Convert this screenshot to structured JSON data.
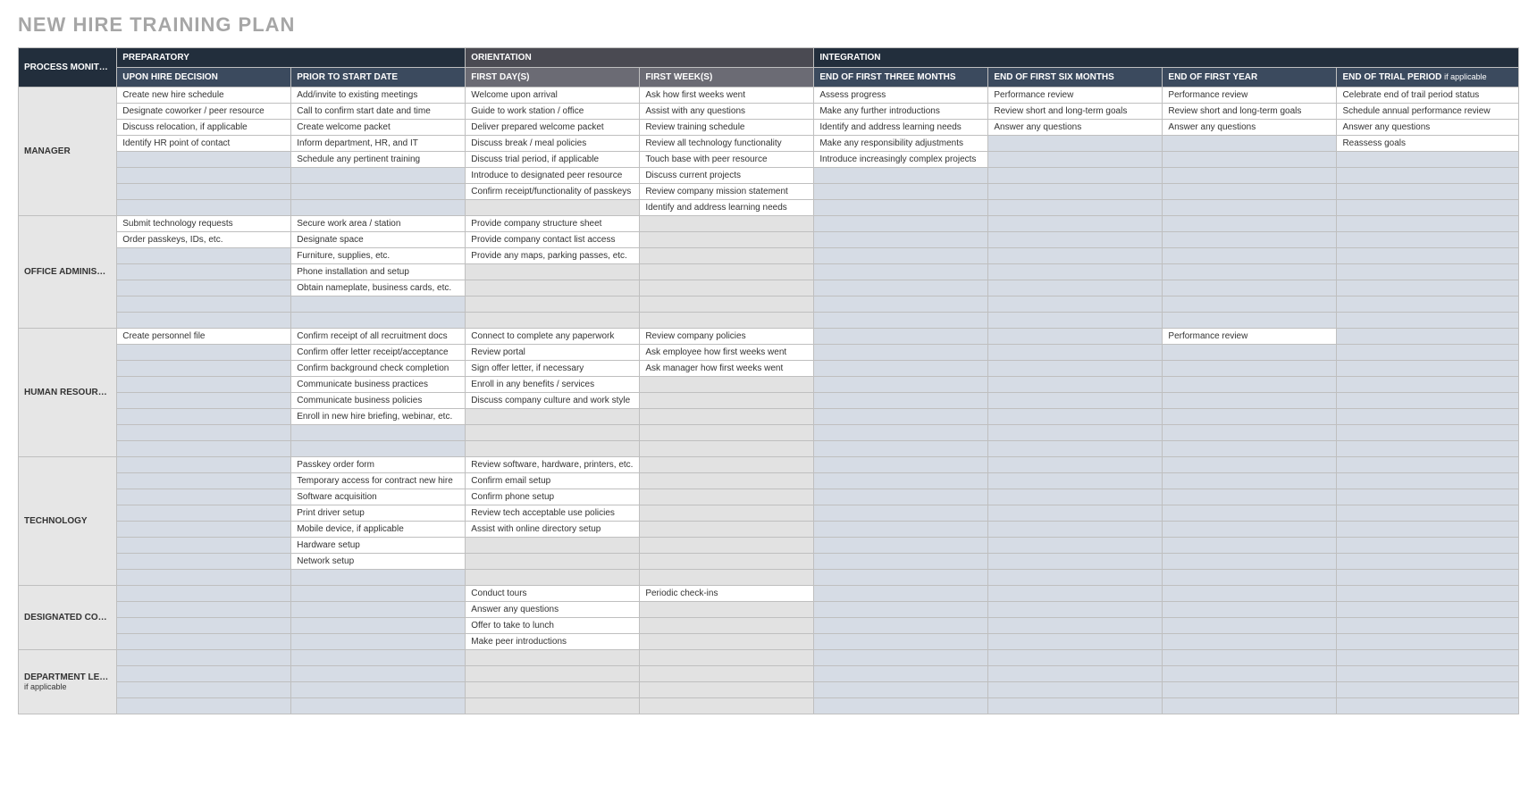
{
  "title": "NEW HIRE TRAINING PLAN",
  "cornerHeader": "PROCESS MONITOR / MENTOR",
  "phaseHeaders": {
    "prep": "PREPARATORY",
    "orient": "ORIENTATION",
    "integ": "INTEGRATION"
  },
  "subHeaders": {
    "uponHire": "UPON HIRE DECISION",
    "priorStart": "PRIOR TO START DATE",
    "firstDays": "FIRST DAY(S)",
    "firstWeeks": "FIRST WEEK(S)",
    "threeMonths": "END OF FIRST THREE MONTHS",
    "sixMonths": "END OF FIRST SIX MONTHS",
    "firstYear": "END OF FIRST YEAR",
    "trialPeriod": "END OF TRIAL PERIOD",
    "trialNote": "if applicable"
  },
  "roles": {
    "manager": "MANAGER",
    "officeAdmin": "OFFICE ADMINISTRATOR",
    "hr": "HUMAN RESOURCES",
    "tech": "TECHNOLOGY",
    "coworker": "DESIGNATED COWORKER / PEER RESOURCE",
    "deptLead": "DEPARTMENT LEAD",
    "deptNote": "if applicable"
  },
  "sections": {
    "manager": {
      "rows": 8,
      "cells": {
        "0.0": "Create new hire schedule",
        "0.1": "Add/invite to existing meetings",
        "0.2": "Welcome upon arrival",
        "0.3": "Ask how first weeks went",
        "0.4": "Assess progress",
        "0.5": "Performance review",
        "0.6": "Performance review",
        "0.7": "Celebrate end of trail period status",
        "1.0": "Designate coworker / peer resource",
        "1.1": "Call to confirm start date and time",
        "1.2": "Guide to work station / office",
        "1.3": "Assist with any questions",
        "1.4": "Make any further introductions",
        "1.5": "Review short and long-term goals",
        "1.6": "Review short and long-term goals",
        "1.7": "Schedule annual performance review",
        "2.0": "Discuss relocation, if applicable",
        "2.1": "Create welcome packet",
        "2.2": "Deliver prepared welcome packet",
        "2.3": "Review training schedule",
        "2.4": "Identify and address learning needs",
        "2.5": "Answer any questions",
        "2.6": "Answer any questions",
        "2.7": "Answer any questions",
        "3.0": "Identify HR point of contact",
        "3.1": "Inform department, HR, and IT",
        "3.2": "Discuss break / meal policies",
        "3.3": "Review all technology functionality",
        "3.4": "Make any responsibility adjustments",
        "3.7": "Reassess goals",
        "4.1": "Schedule any pertinent training",
        "4.2": "Discuss trial period, if applicable",
        "4.3": "Touch base with peer resource",
        "4.4": "Introduce increasingly complex projects",
        "5.2": "Introduce to designated peer resource",
        "5.3": "Discuss current projects",
        "6.2": "Confirm receipt/functionality of passkeys",
        "6.3": "Review company mission statement",
        "7.3": "Identify and address learning needs"
      }
    },
    "officeAdmin": {
      "rows": 7,
      "cells": {
        "0.0": "Submit technology requests",
        "0.1": "Secure work area / station",
        "0.2": "Provide company structure sheet",
        "1.0": "Order passkeys, IDs, etc.",
        "1.1": "Designate space",
        "1.2": "Provide company contact list access",
        "2.1": "Furniture, supplies, etc.",
        "2.2": "Provide any maps, parking passes, etc.",
        "3.1": "Phone installation and setup",
        "4.1": "Obtain nameplate, business cards, etc."
      }
    },
    "hr": {
      "rows": 8,
      "cells": {
        "0.0": "Create personnel file",
        "0.1": "Confirm receipt of all recruitment docs",
        "0.2": "Connect to complete any paperwork",
        "0.3": "Review company policies",
        "0.6": "Performance review",
        "1.1": "Confirm offer letter receipt/acceptance",
        "1.2": "Review portal",
        "1.3": "Ask employee how first weeks went",
        "2.1": "Confirm background check completion",
        "2.2": "Sign offer letter, if necessary",
        "2.3": "Ask manager how first weeks went",
        "3.1": "Communicate business practices",
        "3.2": "Enroll in any benefits / services",
        "4.1": "Communicate business policies",
        "4.2": "Discuss company culture and work style",
        "5.1": "Enroll in new hire briefing, webinar, etc."
      }
    },
    "tech": {
      "rows": 8,
      "cells": {
        "0.1": "Passkey order form",
        "0.2": "Review software, hardware, printers, etc.",
        "1.1": "Temporary access for contract new hire",
        "1.2": "Confirm email setup",
        "2.1": "Software acquisition",
        "2.2": "Confirm phone setup",
        "3.1": "Print driver setup",
        "3.2": "Review tech acceptable use policies",
        "4.1": "Mobile device, if applicable",
        "4.2": "Assist with online directory setup",
        "5.1": "Hardware setup",
        "6.1": "Network setup"
      }
    },
    "coworker": {
      "rows": 4,
      "cells": {
        "0.2": "Conduct tours",
        "0.3": "Periodic check-ins",
        "1.2": "Answer any questions",
        "2.2": "Offer to take to lunch",
        "3.2": "Make peer introductions"
      }
    },
    "deptLead": {
      "rows": 4,
      "cells": {}
    }
  }
}
